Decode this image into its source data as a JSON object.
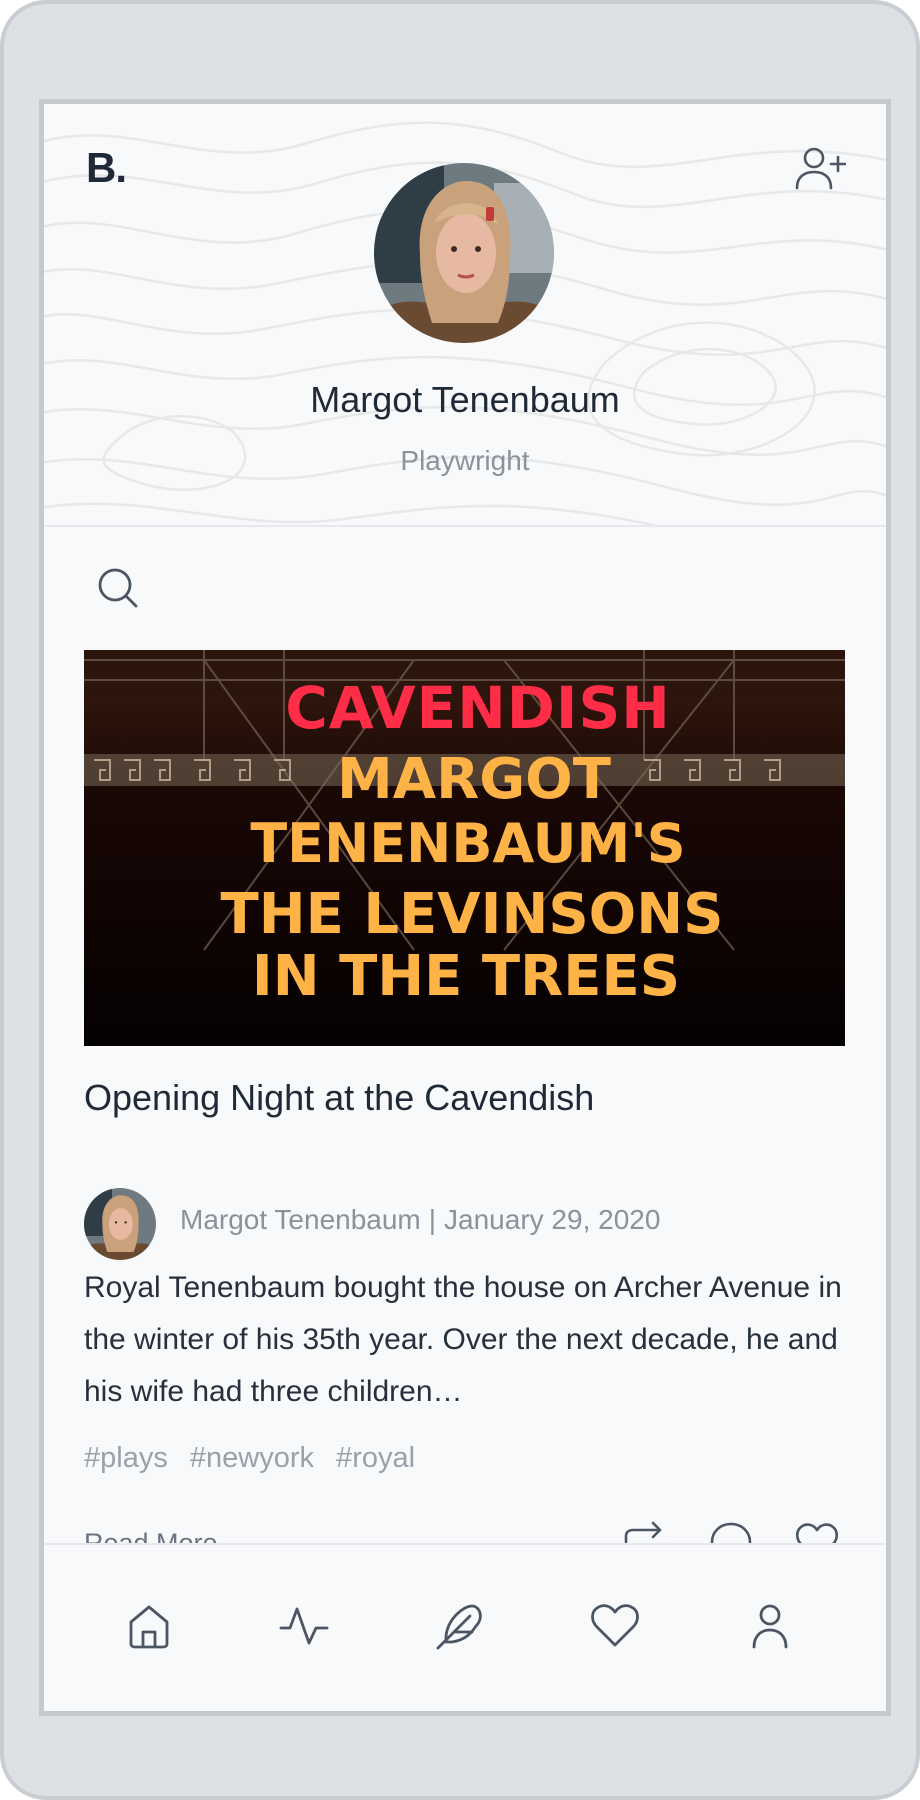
{
  "brand": {
    "logo": "B."
  },
  "profile": {
    "name": "Margot Tenenbaum",
    "role": "Playwright"
  },
  "header_actions": {
    "add_user_icon": "user-plus-icon"
  },
  "search": {
    "icon": "search-icon"
  },
  "post": {
    "image_text": {
      "line1": "CAVENDISH",
      "line2": "MARGOT",
      "line3": "TENENBAUM'S",
      "line4": "THE LEVINSONS",
      "line5": "IN THE TREES"
    },
    "title": "Opening Night at the Cavendish",
    "author": "Margot Tenenbaum",
    "separator": "|",
    "date": "January 29, 2020",
    "excerpt": "Royal Tenenbaum bought the house on Archer Avenue in the winter of his 35th year. Over the next decade, he and his wife had three children…",
    "tags": [
      "#plays",
      "#newyork",
      "#royal"
    ],
    "read_more": "Read More",
    "actions": [
      "share-icon",
      "comment-icon",
      "heart-icon"
    ]
  },
  "tabbar": {
    "items": [
      "home-icon",
      "activity-icon",
      "feather-icon",
      "heart-icon",
      "user-icon"
    ]
  },
  "colors": {
    "marquee_red": "#ff2d47",
    "marquee_amber": "#ffb347",
    "text_muted": "#8a929c",
    "icon_stroke": "#4b5563"
  }
}
